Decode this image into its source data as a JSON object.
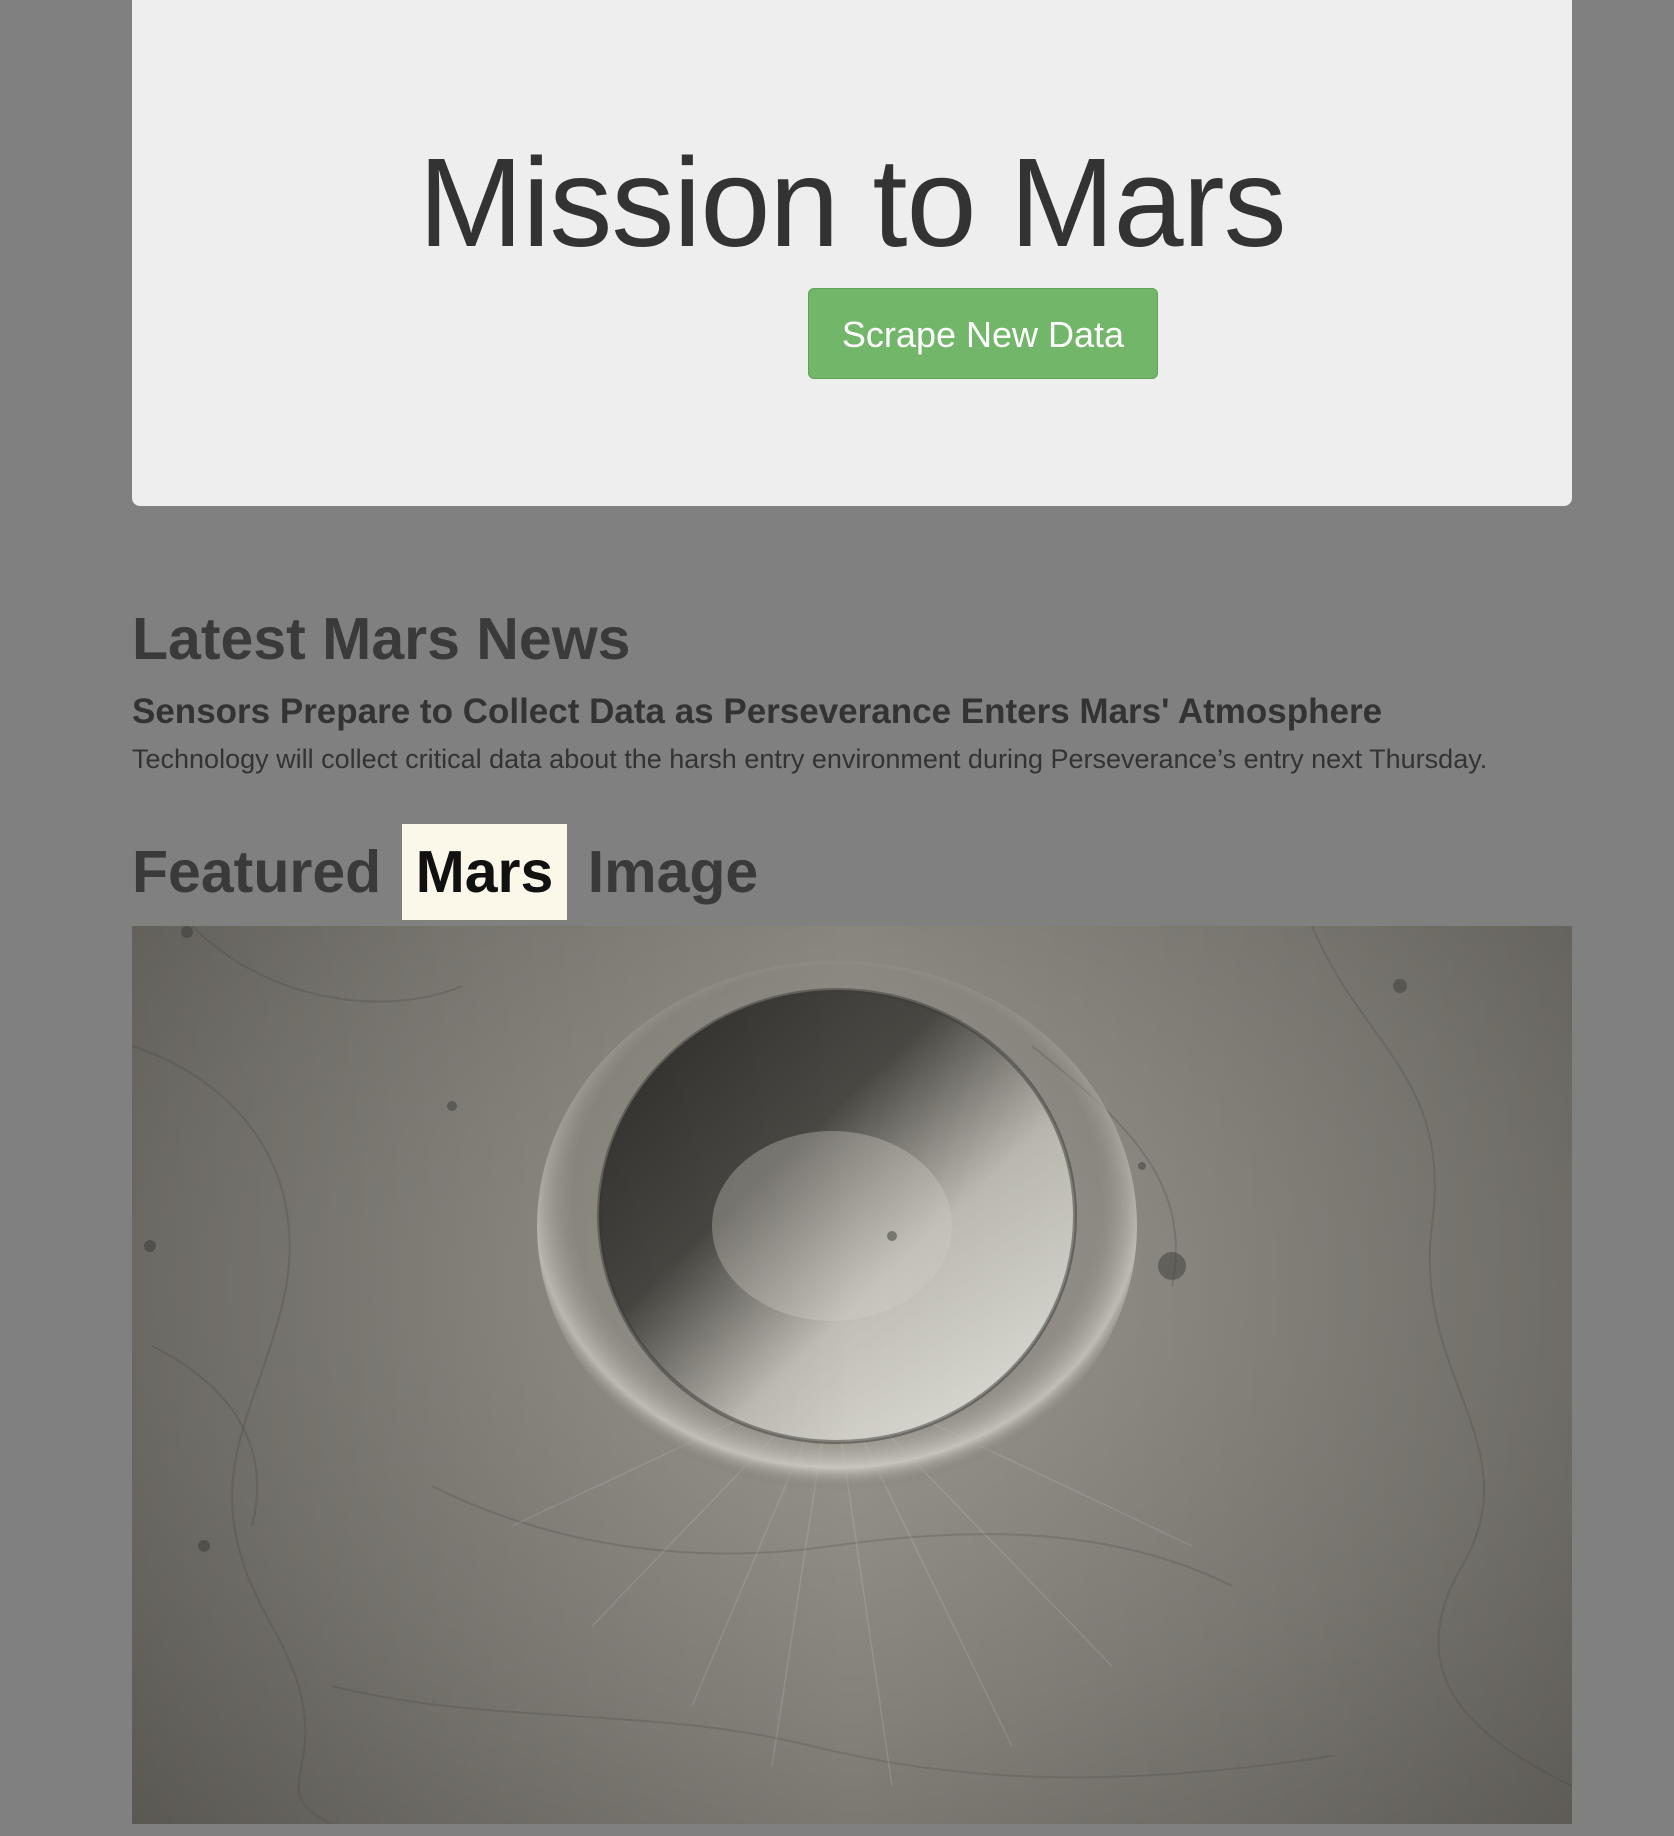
{
  "jumbotron": {
    "title": "Mission to Mars",
    "scrape_button_label": "Scrape New Data"
  },
  "news": {
    "section_heading": "Latest Mars News",
    "title": "Sensors Prepare to Collect Data as Perseverance Enters Mars' Atmosphere",
    "teaser": "Technology will collect critical data about the harsh entry environment during Perseverance’s entry next Thursday."
  },
  "featured": {
    "heading_before": "Featured",
    "heading_highlight": "Mars",
    "heading_after": "Image"
  },
  "colors": {
    "page_background": "#808080",
    "jumbotron_background": "#eeeeee",
    "button_green": "#72b769",
    "highlight": "#fbf8e9"
  }
}
